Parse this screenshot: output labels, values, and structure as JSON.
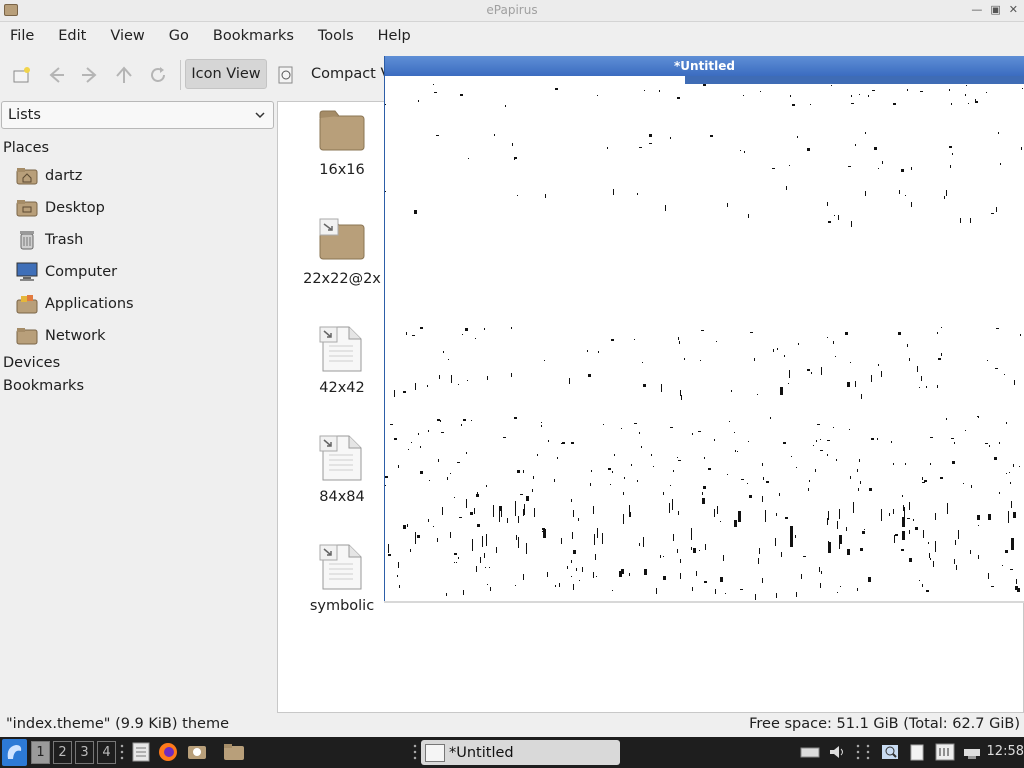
{
  "window": {
    "title": "ePapirus"
  },
  "menu": [
    "File",
    "Edit",
    "View",
    "Go",
    "Bookmarks",
    "Tools",
    "Help"
  ],
  "toolbar": {
    "icon_view_label": "Icon View",
    "compact_view_label": "Compact V"
  },
  "location": {
    "selected": "Lists"
  },
  "sidebar": {
    "places_header": "Places",
    "places": [
      {
        "label": "dartz",
        "icon": "home-folder-icon"
      },
      {
        "label": "Desktop",
        "icon": "desktop-folder-icon"
      },
      {
        "label": "Trash",
        "icon": "trash-icon"
      },
      {
        "label": "Computer",
        "icon": "computer-icon"
      },
      {
        "label": "Applications",
        "icon": "applications-icon"
      },
      {
        "label": "Network",
        "icon": "network-icon"
      }
    ],
    "devices_header": "Devices",
    "bookmarks_header": "Bookmarks"
  },
  "files": [
    {
      "label": "16x16",
      "icon": "folder-icon"
    },
    {
      "label": "22x22@2x",
      "icon": "folder-link-icon"
    },
    {
      "label": "42x42",
      "icon": "file-link-icon"
    },
    {
      "label": "84x84",
      "icon": "file-link-icon"
    },
    {
      "label": "symbolic",
      "icon": "file-link-icon"
    }
  ],
  "status": {
    "left": "\"index.theme\" (9.9 KiB) theme",
    "right": "Free space: 51.1 GiB (Total: 62.7 GiB)"
  },
  "image_window": {
    "title": "*Untitled"
  },
  "taskbar": {
    "workspaces": [
      "1",
      "2",
      "3",
      "4"
    ],
    "active_workspace": "1",
    "task_label": "*Untitled",
    "clock": "12:58"
  },
  "colors": {
    "accent": "#3b6cc0",
    "taskbar": "#1e1e1e",
    "folder": "#b89f7a"
  }
}
